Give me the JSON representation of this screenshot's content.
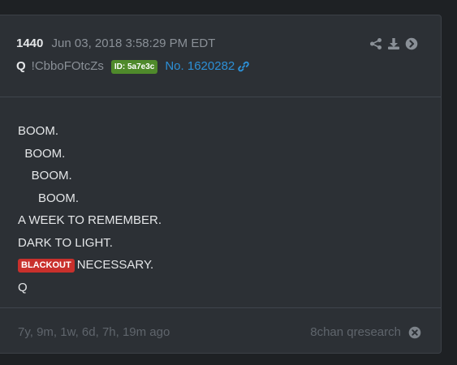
{
  "post": {
    "number": "1440",
    "date": "Jun 03, 2018 3:58:29 PM EDT",
    "author": "Q",
    "tripcode": "!CbboFOtcZs",
    "id_badge": "ID: 5a7e3c",
    "post_ref": "No. 1620282"
  },
  "actions": [
    "share-icon",
    "download-icon",
    "arrow-right-circle-icon"
  ],
  "body": {
    "lines": [
      "BOOM.",
      "  BOOM.",
      "    BOOM.",
      "      BOOM.",
      "A WEEK TO REMEMBER.",
      "DARK TO LIGHT."
    ],
    "blackout_badge": "BLACKOUT",
    "necessary_text": "NECESSARY.",
    "signature": "Q"
  },
  "footer": {
    "elapsed": "7y, 9m, 1w, 6d, 7h, 19m ago",
    "source": "8chan qresearch"
  },
  "colors": {
    "background": "#1e2124",
    "card": "#2c3035",
    "link": "#2c8fd6",
    "id_badge": "#4f8a2b",
    "blackout_badge": "#c9302c"
  }
}
